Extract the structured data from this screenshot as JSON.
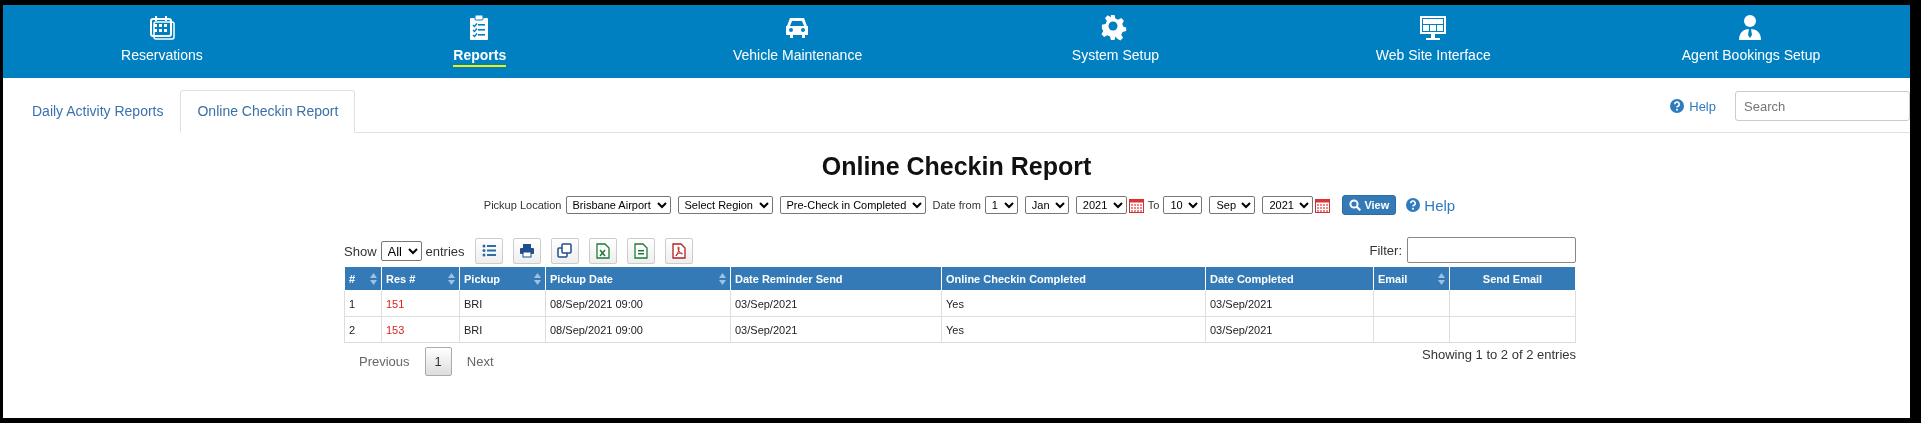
{
  "nav": [
    {
      "label": "Reservations",
      "selected": false
    },
    {
      "label": "Reports",
      "selected": true
    },
    {
      "label": "Vehicle Maintenance",
      "selected": false
    },
    {
      "label": "System Setup",
      "selected": false
    },
    {
      "label": "Web Site Interface",
      "selected": false
    },
    {
      "label": "Agent Bookings Setup",
      "selected": false
    }
  ],
  "tabs": [
    {
      "label": "Daily Activity Reports",
      "selected": false
    },
    {
      "label": "Online Checkin Report",
      "selected": true
    }
  ],
  "help": "Help",
  "search": {
    "placeholder": "Search"
  },
  "title": "Online Checkin Report",
  "filters": [
    {
      "kind": "label",
      "text": "Pickup Location"
    },
    {
      "kind": "select",
      "value": "Brisbane Airport"
    },
    {
      "kind": "select",
      "value": "Select Region"
    },
    {
      "kind": "select",
      "value": "Pre-Check in Completed"
    },
    {
      "kind": "label",
      "text": "Date from"
    },
    {
      "kind": "select",
      "value": "1"
    },
    {
      "kind": "select",
      "value": "Jan"
    },
    {
      "kind": "select",
      "value": "2021"
    },
    {
      "kind": "calendar"
    },
    {
      "kind": "label",
      "text": "To"
    },
    {
      "kind": "select",
      "value": "10"
    },
    {
      "kind": "select",
      "value": "Sep"
    },
    {
      "kind": "select",
      "value": "2021"
    },
    {
      "kind": "calendar"
    },
    {
      "kind": "button",
      "text": "View"
    },
    {
      "kind": "help",
      "text": "Help"
    }
  ],
  "table": {
    "show_label": "Show",
    "length": "All",
    "entries_label": "entries",
    "filter_label": "Filter:",
    "columns": [
      {
        "label": "#",
        "sortable": true
      },
      {
        "label": "Res #",
        "sortable": true,
        "kind": "link"
      },
      {
        "label": "Pickup",
        "sortable": true
      },
      {
        "label": "Pickup Date",
        "sortable": true
      },
      {
        "label": "Date Reminder Send",
        "sortable": false
      },
      {
        "label": "Online Checkin Completed",
        "sortable": false
      },
      {
        "label": "Date Completed",
        "sortable": false
      },
      {
        "label": "Email",
        "sortable": true
      },
      {
        "label": "Send Email",
        "sortable": false
      }
    ],
    "rows": [
      [
        "1",
        "151",
        "BRI",
        "08/Sep/2021 09:00",
        "03/Sep/2021",
        "Yes",
        "03/Sep/2021",
        null,
        null
      ],
      [
        "2",
        "153",
        "BRI",
        "08/Sep/2021 09:00",
        "03/Sep/2021",
        "Yes",
        "03/Sep/2021",
        null,
        null
      ]
    ],
    "info": "Showing 1 to 2 of 2 entries",
    "pagination": [
      {
        "label": "Previous",
        "selected": false,
        "disabled": true
      },
      {
        "label": "1",
        "selected": true,
        "disabled": false
      },
      {
        "label": "Next",
        "selected": false,
        "disabled": true
      }
    ]
  }
}
